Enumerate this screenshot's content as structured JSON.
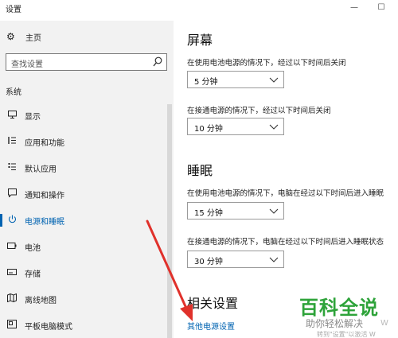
{
  "window": {
    "title": "设置"
  },
  "sidebar": {
    "home_label": "主页",
    "search_placeholder": "查找设置",
    "section_label": "系统",
    "items": [
      {
        "label": "显示",
        "icon": "monitor-icon"
      },
      {
        "label": "应用和功能",
        "icon": "apps-list-icon"
      },
      {
        "label": "默认应用",
        "icon": "default-apps-icon"
      },
      {
        "label": "通知和操作",
        "icon": "notification-icon"
      },
      {
        "label": "电源和睡眠",
        "icon": "power-icon",
        "active": true
      },
      {
        "label": "电池",
        "icon": "battery-icon"
      },
      {
        "label": "存储",
        "icon": "storage-icon"
      },
      {
        "label": "离线地图",
        "icon": "map-icon"
      },
      {
        "label": "平板电脑模式",
        "icon": "tablet-icon"
      }
    ]
  },
  "main": {
    "screen_heading": "屏幕",
    "screen_battery_label": "在使用电池电源的情况下，经过以下时间后关闭",
    "screen_battery_value": "5 分钟",
    "screen_plugged_label": "在接通电源的情况下，经过以下时间后关闭",
    "screen_plugged_value": "10 分钟",
    "sleep_heading": "睡眠",
    "sleep_battery_label": "在使用电池电源的情况下，电脑在经过以下时间后进入睡眠",
    "sleep_battery_value": "15 分钟",
    "sleep_plugged_label": "在接通电源的情况下，电脑在经过以下时间后进入睡眠状态",
    "sleep_plugged_value": "30 分钟",
    "related_heading": "相关设置",
    "other_power_link": "其他电源设置"
  },
  "watermark": {
    "brand": "百科全说",
    "slogan": "助你轻松解决",
    "tiny": "转到\"设置\"以激活 W",
    "side": "W"
  },
  "colors": {
    "accent": "#0063b1",
    "arrow": "#e0312b",
    "watermark": "#2ea33a"
  }
}
